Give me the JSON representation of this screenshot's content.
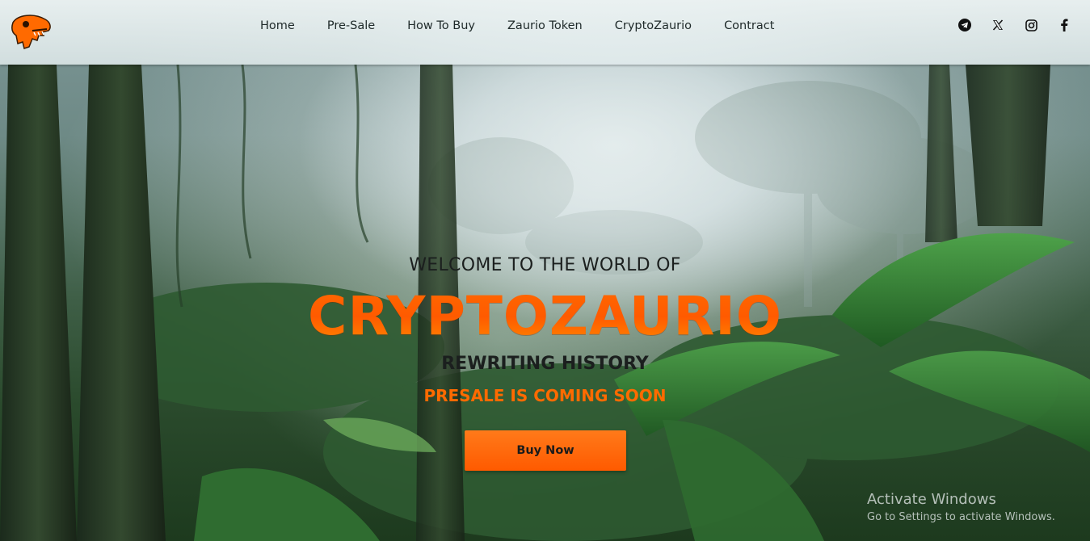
{
  "nav": {
    "logo": "dinosaur-skull-logo",
    "links": [
      "Home",
      "Pre-Sale",
      "How To Buy",
      "Zaurio Token",
      "CryptoZaurio",
      "Contract"
    ],
    "socials": [
      "telegram-icon",
      "x-icon",
      "instagram-icon",
      "facebook-icon"
    ]
  },
  "hero": {
    "welcome": "WELCOME TO THE WORLD OF",
    "brand": "CRYPTOZAURIO",
    "tagline": "REWRITING HISTORY",
    "presale": "PRESALE IS COMING SOON",
    "button_label": "Buy Now"
  },
  "colors": {
    "accent": "#ff6a00",
    "nav_bg": "#eef3f3",
    "text_dark": "#1b1f1e"
  },
  "watermark": {
    "title": "Activate Windows",
    "subtitle": "Go to Settings to activate Windows."
  }
}
